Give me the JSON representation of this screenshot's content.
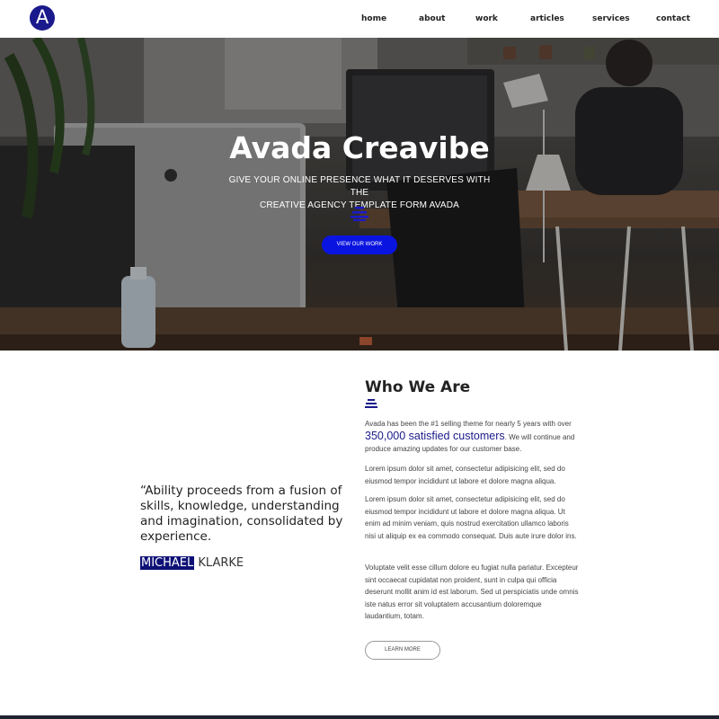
{
  "header": {
    "logo_letter": "A",
    "nav": [
      "home",
      "about",
      "work",
      "articles",
      "services",
      "contact"
    ]
  },
  "hero": {
    "title": "Avada Creavibe",
    "subtitle_line1": "GIVE YOUR ONLINE PRESENCE WHAT IT DESERVES WITH THE",
    "subtitle_line2": "CREATIVE AGENCY TEMPLATE FORM AVADA",
    "button_label": "VIEW OUR WORK",
    "separator_icon": "bars-icon"
  },
  "quote": {
    "text": "“Ability proceeds from a fusion of skills, knowledge, understanding and imagination, consolidated by experience.",
    "author_highlight": "MICHAEL",
    "author_rest": " KLARKE"
  },
  "about": {
    "title": "Who We Are",
    "p1_before": "Avada has been the #1 selling theme for nearly 5 years with over ",
    "p1_highlight": "350,000 satisfied customers",
    "p1_after": ". We will continue and produce amazing updates for our customer base.",
    "p2": "Lorem ipsum dolor sit amet, consectetur adipisicing elit, sed do eiusmod tempor incididunt ut labore et dolore magna aliqua.",
    "p3": "Lorem ipsum dolor sit amet, consectetur adipisicing elit, sed do eiusmod tempor incididunt ut labore et dolore magna aliqua. Ut enim ad minim veniam, quis nostrud exercitation ullamco laboris nisi ut aliquip ex ea commodo consequat. Duis aute irure dolor ins.",
    "p4": "Voluptate velit esse cillum dolore eu fugiat nulla pariatur. Excepteur sint occaecat cupidatat non proident, sunt in culpa qui officia deserunt mollit anim id est laborum. Sed ut perspiciatis unde omnis iste natus error sit voluptatem accusantium doloremque laudantium, totam.",
    "button_label": "LEARN MORE"
  },
  "colors": {
    "brand": "#1a1a8c",
    "hero_button": "#0a14e0",
    "highlight_bg": "#0d1075"
  }
}
